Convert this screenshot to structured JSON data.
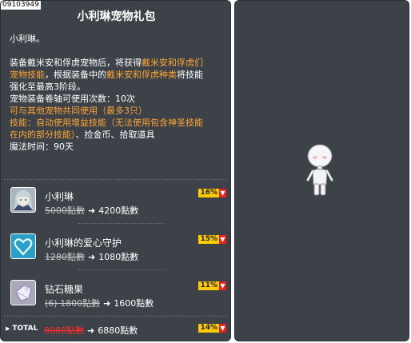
{
  "item_id": "09103949",
  "title": "小利琳宠物礼包",
  "desc": {
    "line1": "小利琳。",
    "l3a": "装备戴米安和俘虏宠物后，将获得",
    "l3b": "戴米安和俘虏们",
    "l4a": "宠物技能",
    "l4b": "，根据装备中的",
    "l4c": "戴米安和俘虏种类",
    "l4d": "将技能",
    "l5": "强化至最高3阶段。",
    "l6": "宠物装备卷轴可使用次数：10次",
    "l7": "可与其他宠物共同使用（最多3只）",
    "l8": "技能：自动使用增益技能（无法使用包含神圣技能",
    "l9a": "在内的部分技能）",
    "l9b": "、捡金币、拾取道具",
    "l10": "魔法时间：90天"
  },
  "products": [
    {
      "name": "小利琳",
      "old_price": "5000點數",
      "new_price": "4200點數",
      "discount": "16%",
      "icon": "pet-girl-icon"
    },
    {
      "name": "小利琳的爱心守护",
      "old_price": "1280點數",
      "new_price": "1080點數",
      "discount": "15%",
      "icon": "heart-icon"
    },
    {
      "name": "钻石糖果",
      "old_price": "(6) 1800點數",
      "new_price": "1600點數",
      "discount": "11%",
      "icon": "diamond-candy-icon"
    }
  ],
  "total": {
    "label": "TOTAL",
    "old_price": "8080點數",
    "new_price": "6880點數",
    "discount": "14%"
  },
  "arrow": "➜",
  "down_mark": "▼",
  "colors": {
    "panel": "#3c4248",
    "highlight": "#ffa533",
    "badge": "#ffcc00",
    "badge_down": "#e82020",
    "total_old": "#ff2a2a"
  }
}
